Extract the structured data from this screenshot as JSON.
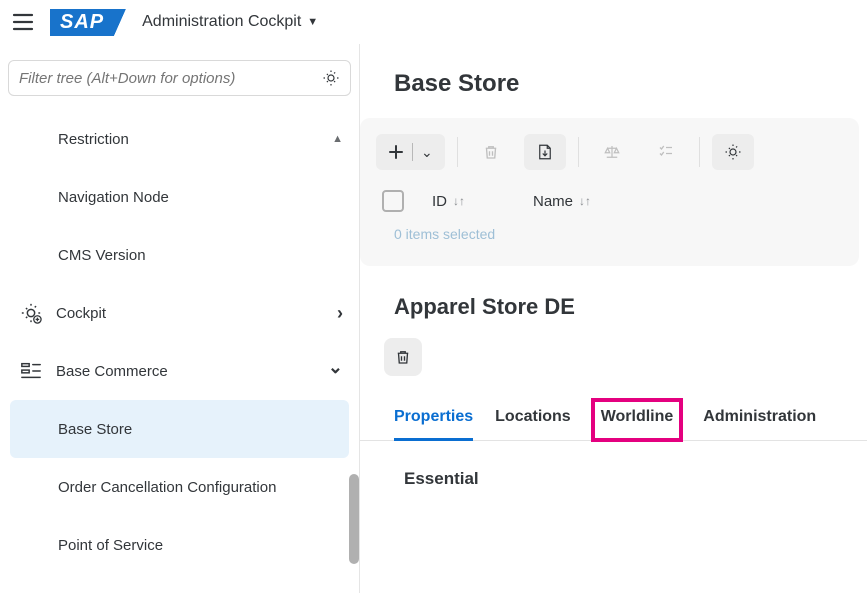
{
  "topbar": {
    "app_title": "Administration Cockpit"
  },
  "filter": {
    "placeholder": "Filter tree (Alt+Down for options)"
  },
  "tree": {
    "items": [
      {
        "label": "Restriction",
        "indent": 1,
        "collapse_up": true
      },
      {
        "label": "Navigation Node",
        "indent": 1
      },
      {
        "label": "CMS Version",
        "indent": 1
      },
      {
        "label": "Cockpit",
        "indent": 0,
        "icon": "gear-cog",
        "chev": "right"
      },
      {
        "label": "Base Commerce",
        "indent": 0,
        "icon": "commerce",
        "chev": "down"
      },
      {
        "label": "Base Store",
        "indent": 1,
        "active": true
      },
      {
        "label": "Order Cancellation Configuration",
        "indent": 1
      },
      {
        "label": "Point of Service",
        "indent": 1
      }
    ]
  },
  "page": {
    "title": "Base Store",
    "columns": [
      {
        "key": "id",
        "label": "ID"
      },
      {
        "key": "name",
        "label": "Name"
      }
    ],
    "selection_status": "0 items selected"
  },
  "detail": {
    "title": "Apparel Store DE",
    "tabs": [
      {
        "label": "Properties",
        "active": true
      },
      {
        "label": "Locations"
      },
      {
        "label": "Worldline",
        "highlight": true
      },
      {
        "label": "Administration"
      }
    ],
    "section": "Essential"
  }
}
